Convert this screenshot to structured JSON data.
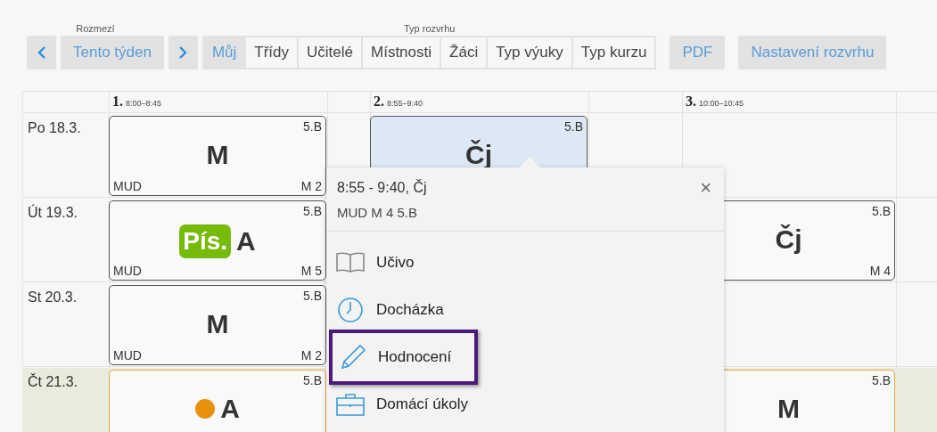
{
  "toolbar": {
    "range_label": "Rozmezí",
    "this_week": "Tento týden",
    "type_label": "Typ rozvrhu",
    "tabs": [
      {
        "label": "Můj",
        "selected": true
      },
      {
        "label": "Třídy",
        "selected": false
      },
      {
        "label": "Učitelé",
        "selected": false
      },
      {
        "label": "Místnosti",
        "selected": false
      },
      {
        "label": "Žáci",
        "selected": false
      },
      {
        "label": "Typ výuky",
        "selected": false
      },
      {
        "label": "Typ kurzu",
        "selected": false
      }
    ],
    "buttons": [
      "PDF",
      "Nastavení rozvrhu"
    ]
  },
  "timetable": {
    "periods": [
      {
        "number": "1.",
        "time": "8:00–8:45"
      },
      {
        "number": "2.",
        "time": "8:55–9:40"
      },
      {
        "number": "3.",
        "time": "10:00–10:45"
      }
    ],
    "days": [
      {
        "label": "Po 18.3.",
        "highlighted": false,
        "cells": [
          {
            "kind": "lesson",
            "subject": "M",
            "class": "5.B",
            "teacher": "MUD",
            "room": "M 2",
            "selected": false,
            "highlighted": false
          },
          {
            "kind": "empty"
          },
          {
            "kind": "lesson",
            "subject": "Čj",
            "class": "5.B",
            "selected": true,
            "highlighted": false
          },
          {
            "kind": "empty"
          },
          {
            "kind": "empty"
          },
          {
            "kind": "empty"
          }
        ]
      },
      {
        "label": "Út 19.3.",
        "highlighted": false,
        "cells": [
          {
            "kind": "lesson",
            "subject": "A",
            "class": "5.B",
            "teacher": "MUD",
            "room": "M 5",
            "badge": "Pís.",
            "selected": false,
            "highlighted": false
          },
          {
            "kind": "empty"
          },
          {
            "kind": "empty"
          },
          {
            "kind": "empty"
          },
          {
            "kind": "lesson",
            "subject": "Čj",
            "class": "5.B",
            "room": "M 4",
            "selected": false,
            "highlighted": false
          },
          {
            "kind": "empty"
          }
        ]
      },
      {
        "label": "St 20.3.",
        "highlighted": false,
        "cells": [
          {
            "kind": "lesson",
            "subject": "M",
            "class": "5.B",
            "teacher": "MUD",
            "room": "M 2",
            "selected": false,
            "highlighted": false
          },
          {
            "kind": "empty"
          },
          {
            "kind": "empty"
          },
          {
            "kind": "empty"
          },
          {
            "kind": "empty"
          },
          {
            "kind": "empty"
          }
        ]
      },
      {
        "label": "Čt 21.3.",
        "highlighted": true,
        "cells": [
          {
            "kind": "lesson",
            "subject": "A",
            "class": "5.B",
            "color": "#e8900c",
            "selected": false,
            "highlighted": true
          },
          {
            "kind": "empty"
          },
          {
            "kind": "empty"
          },
          {
            "kind": "empty"
          },
          {
            "kind": "lesson",
            "subject": "M",
            "class": "5.B",
            "selected": false,
            "highlighted": true
          },
          {
            "kind": "empty"
          }
        ]
      }
    ]
  },
  "popup": {
    "title": "8:55 - 9:40, Čj",
    "subtitle": "MUD M 4 5.B",
    "close": "×",
    "items": [
      {
        "kind": "book",
        "label": "Učivo",
        "highlighted": false
      },
      {
        "kind": "clock",
        "label": "Docházka",
        "highlighted": false
      },
      {
        "kind": "pencil",
        "label": "Hodnocení",
        "highlighted": true
      },
      {
        "kind": "briefcase",
        "label": "Domácí úkoly",
        "highlighted": false
      }
    ]
  }
}
